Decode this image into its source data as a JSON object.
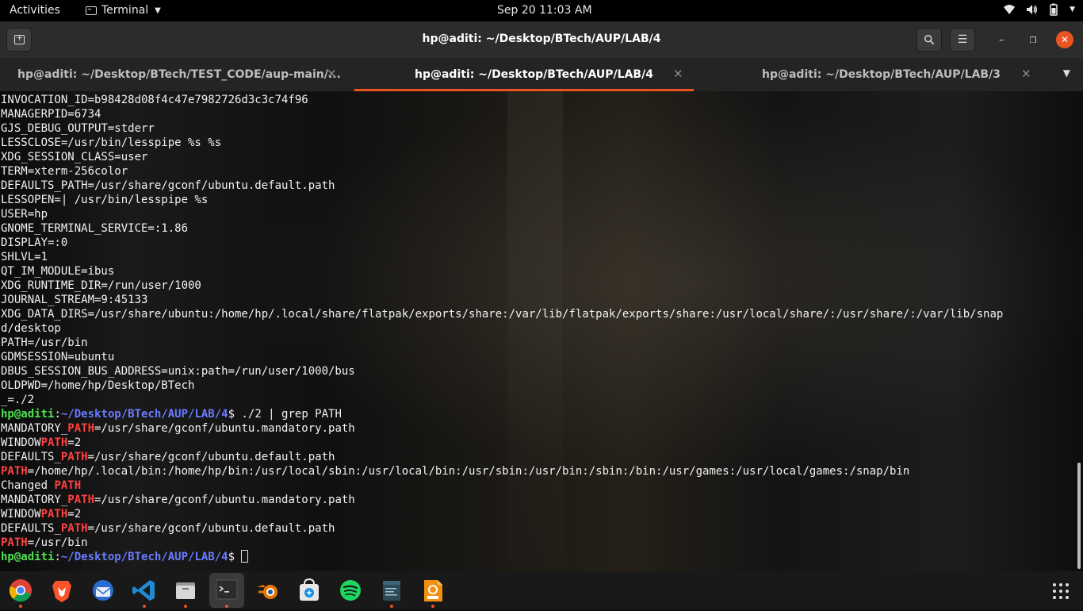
{
  "topbar": {
    "activities": "Activities",
    "app_menu": "Terminal",
    "clock": "Sep 20  11:03 AM",
    "tray_icons": [
      "wifi-icon",
      "volume-icon",
      "battery-icon",
      "power-menu-icon"
    ]
  },
  "header": {
    "title": "hp@aditi: ~/Desktop/BTech/AUP/LAB/4",
    "buttons": [
      "new-tab-icon",
      "search-icon",
      "hamburger-menu-icon",
      "minimize-icon",
      "maximize-icon",
      "close-icon"
    ]
  },
  "tabs": [
    {
      "label": "hp@aditi: ~/Desktop/BTech/TEST_CODE/aup-main/...",
      "active": false
    },
    {
      "label": "hp@aditi: ~/Desktop/BTech/AUP/LAB/4",
      "active": true
    },
    {
      "label": "hp@aditi: ~/Desktop/BTech/AUP/LAB/3",
      "active": false
    }
  ],
  "terminal": {
    "env_lines": [
      "INVOCATION_ID=b98428d08f4c47e7982726d3c3c74f96",
      "MANAGERPID=6734",
      "GJS_DEBUG_OUTPUT=stderr",
      "LESSCLOSE=/usr/bin/lesspipe %s %s",
      "XDG_SESSION_CLASS=user",
      "TERM=xterm-256color",
      "DEFAULTS_PATH=/usr/share/gconf/ubuntu.default.path",
      "LESSOPEN=| /usr/bin/lesspipe %s",
      "USER=hp",
      "GNOME_TERMINAL_SERVICE=:1.86",
      "DISPLAY=:0",
      "SHLVL=1",
      "QT_IM_MODULE=ibus",
      "XDG_RUNTIME_DIR=/run/user/1000",
      "JOURNAL_STREAM=9:45133",
      "XDG_DATA_DIRS=/usr/share/ubuntu:/home/hp/.local/share/flatpak/exports/share:/var/lib/flatpak/exports/share:/usr/local/share/:/usr/share/:/var/lib/snap",
      "d/desktop",
      "PATH=/usr/bin",
      "GDMSESSION=ubuntu",
      "DBUS_SESSION_BUS_ADDRESS=unix:path=/run/user/1000/bus",
      "OLDPWD=/home/hp/Desktop/BTech",
      "_=./2"
    ],
    "prompt_user": "hp@aditi",
    "prompt_colon": ":",
    "prompt_path": "~/Desktop/BTech/AUP/LAB/4",
    "prompt_symbol": "$",
    "command": " ./2 | grep PATH",
    "grep_lines": [
      {
        "pre": "MANDATORY_",
        "match": "PATH",
        "post": "=/usr/share/gconf/ubuntu.mandatory.path"
      },
      {
        "pre": "WINDOW",
        "match": "PATH",
        "post": "=2"
      },
      {
        "pre": "DEFAULTS_",
        "match": "PATH",
        "post": "=/usr/share/gconf/ubuntu.default.path"
      },
      {
        "pre": "",
        "match": "PATH",
        "post": "=/home/hp/.local/bin:/home/hp/bin:/usr/local/sbin:/usr/local/bin:/usr/sbin:/usr/bin:/sbin:/bin:/usr/games:/usr/local/games:/snap/bin"
      },
      {
        "pre": "Changed ",
        "match": "PATH",
        "post": ""
      },
      {
        "pre": "MANDATORY_",
        "match": "PATH",
        "post": "=/usr/share/gconf/ubuntu.mandatory.path"
      },
      {
        "pre": "WINDOW",
        "match": "PATH",
        "post": "=2"
      },
      {
        "pre": "DEFAULTS_",
        "match": "PATH",
        "post": "=/usr/share/gconf/ubuntu.default.path"
      },
      {
        "pre": "",
        "match": "PATH",
        "post": "=/usr/bin"
      }
    ]
  },
  "dock": {
    "apps": [
      {
        "name": "chrome",
        "running": true,
        "active": false
      },
      {
        "name": "brave",
        "running": false,
        "active": false
      },
      {
        "name": "thunderbird",
        "running": false,
        "active": false
      },
      {
        "name": "vscode",
        "running": true,
        "active": false
      },
      {
        "name": "files",
        "running": true,
        "active": false
      },
      {
        "name": "terminal",
        "running": true,
        "active": true
      },
      {
        "name": "blender",
        "running": false,
        "active": false
      },
      {
        "name": "software-center",
        "running": false,
        "active": false
      },
      {
        "name": "spotify",
        "running": false,
        "active": false
      },
      {
        "name": "text-editor",
        "running": true,
        "active": false
      },
      {
        "name": "pdf-tool",
        "running": true,
        "active": false
      }
    ],
    "show_apps": "show-apps-icon"
  },
  "colors": {
    "accent": "#e95420",
    "prompt_user": "#4ee24e",
    "prompt_path": "#6a7bff",
    "grep_match": "#ff4040"
  }
}
